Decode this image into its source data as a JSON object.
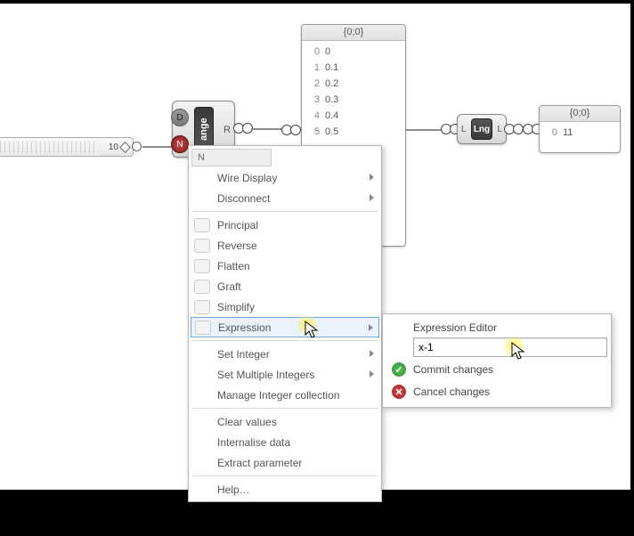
{
  "slider": {
    "value": "10"
  },
  "range_node": {
    "label": "ange",
    "port_D": "D",
    "port_N": "N",
    "port_R": "R"
  },
  "data_panel": {
    "path": "{0;0}",
    "rows": [
      {
        "i": "0",
        "v": "0"
      },
      {
        "i": "1",
        "v": "0.1"
      },
      {
        "i": "2",
        "v": "0.2"
      },
      {
        "i": "3",
        "v": "0.3"
      },
      {
        "i": "4",
        "v": "0.4"
      },
      {
        "i": "5",
        "v": "0.5"
      }
    ]
  },
  "lng_node": {
    "label": "Lng",
    "inL": "L",
    "outL": "L"
  },
  "out_panel": {
    "path": "{0;0}",
    "row_i": "0",
    "row_v": "11"
  },
  "context_menu": {
    "title": "N",
    "wire_display": "Wire Display",
    "disconnect": "Disconnect",
    "principal": "Principal",
    "reverse": "Reverse",
    "flatten": "Flatten",
    "graft": "Graft",
    "simplify": "Simplify",
    "expression": "Expression",
    "set_integer": "Set Integer",
    "set_multiple": "Set Multiple Integers",
    "manage": "Manage Integer collection",
    "clear": "Clear values",
    "internalise": "Internalise data",
    "extract": "Extract parameter",
    "help": "Help…"
  },
  "expr_editor": {
    "title": "Expression Editor",
    "value": "x-1",
    "commit": "Commit changes",
    "cancel": "Cancel changes"
  }
}
